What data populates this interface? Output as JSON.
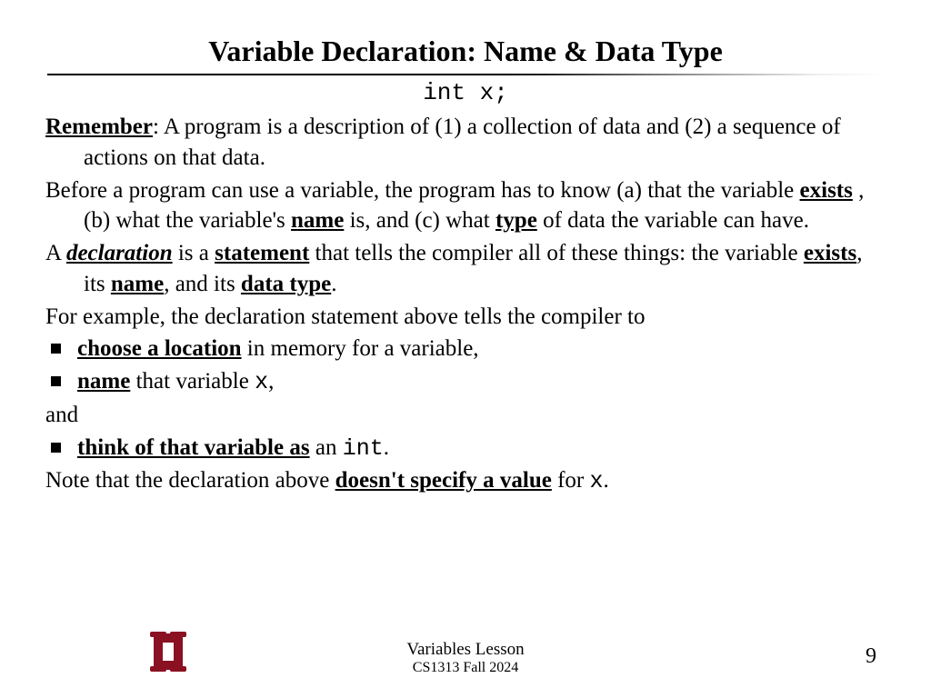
{
  "title": "Variable Declaration: Name & Data Type",
  "code_line": "int x;",
  "p1": {
    "lead": "Remember",
    "rest": ": A program is a description of (1) a collection of data and (2) a sequence of actions on that data."
  },
  "p2": {
    "pre": "Before a program can use a variable, the program has to know (a) that the variable ",
    "w1": "exists",
    "mid1": " , (b) what the variable's ",
    "w2": "name",
    "mid2": " is, and (c) what ",
    "w3": "type",
    "post": " of data the variable can have."
  },
  "p3": {
    "pre": "A ",
    "w1": "declaration",
    "mid1": " is a ",
    "w2": "statement",
    "mid2": " that tells the compiler all of these things: the variable ",
    "w3": "exists",
    "mid3": ", its ",
    "w4": "name",
    "mid4": ", and its ",
    "w5": "data type",
    "post": "."
  },
  "p4": "For example, the declaration statement above tells the compiler to",
  "b1": {
    "w": "choose a location",
    "rest": " in memory for a variable,"
  },
  "b2": {
    "w": "name",
    "mid": " that variable ",
    "code": " x",
    "post": ","
  },
  "and": "and",
  "b3": {
    "w": "think of that variable as",
    "mid": " an ",
    "code": " int",
    "post": "."
  },
  "p5": {
    "pre": "Note that the declaration above ",
    "w": "doesn't specify a value",
    "mid": " for ",
    "code": " x",
    "post": "."
  },
  "footer": {
    "line1": "Variables Lesson",
    "line2": "CS1313 Fall 2024",
    "page": "9"
  }
}
